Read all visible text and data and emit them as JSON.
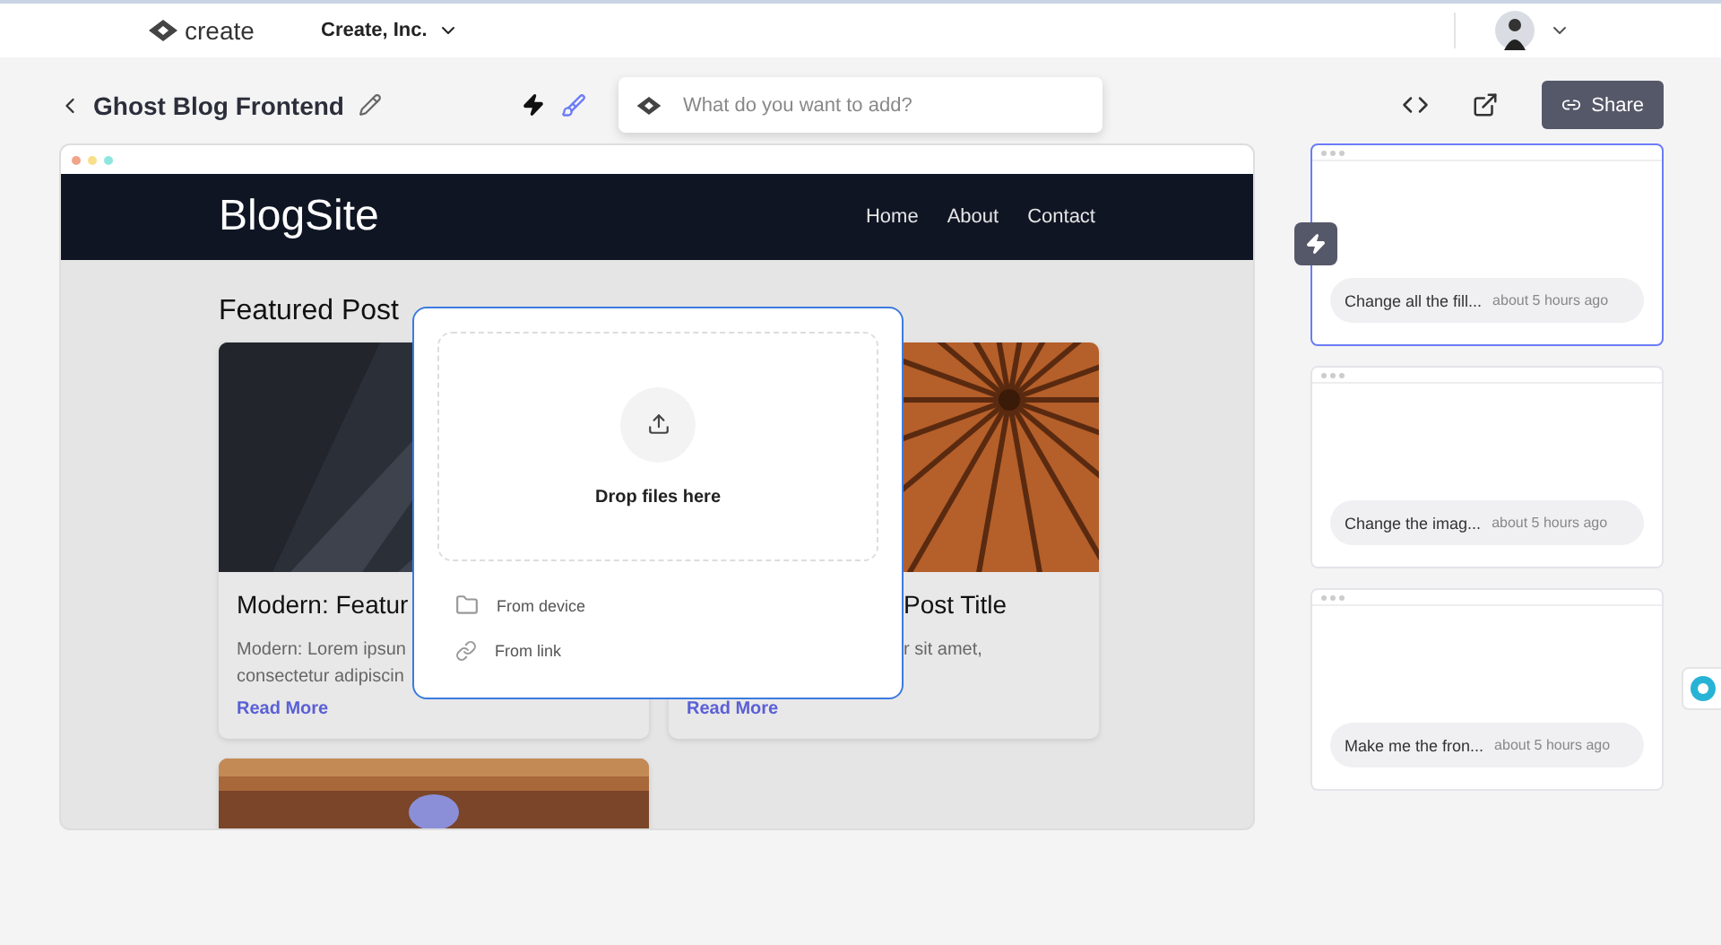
{
  "topbar": {
    "brand": "create",
    "org": "Create, Inc."
  },
  "project": {
    "title": "Ghost Blog Frontend",
    "modes": [
      {
        "kind": "bolt",
        "selected": false
      },
      {
        "kind": "brush",
        "selected": true
      }
    ],
    "prompt": {
      "placeholder": "What do you want to add?"
    },
    "share": "Share"
  },
  "preview": {
    "site_name": "BlogSite",
    "nav": [
      "Home",
      "About",
      "Contact"
    ],
    "heading": "Featured Post",
    "cards": [
      {
        "kind": "left",
        "title": "Modern: Featur",
        "excerpt": [
          "Modern: Lorem ipsun",
          "consectetur adipiscin"
        ],
        "link": "Read More"
      },
      {
        "kind": "right",
        "title": "Post Title",
        "excerpt": [
          "r sit amet,"
        ],
        "link": "Read More"
      },
      {
        "kind": "bottom"
      }
    ]
  },
  "upload": {
    "drop": "Drop files here",
    "options": [
      {
        "kind": "device",
        "label": "From device"
      },
      {
        "kind": "link",
        "label": "From link"
      }
    ]
  },
  "history": [
    {
      "prompt": "Change all the fill...",
      "time": "about 5 hours ago",
      "selected": true
    },
    {
      "prompt": "Change the imag...",
      "time": "about 5 hours ago",
      "selected": false
    },
    {
      "prompt": "Make me the fron...",
      "time": "about 5 hours ago",
      "selected": false
    }
  ]
}
